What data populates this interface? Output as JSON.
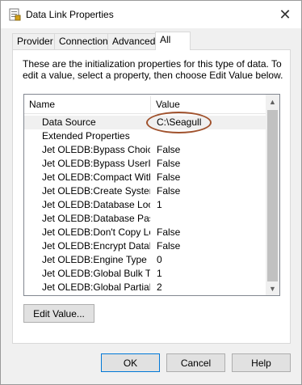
{
  "window": {
    "title": "Data Link Properties",
    "close_glyph": "✕"
  },
  "tabs": [
    {
      "label": "Provider"
    },
    {
      "label": "Connection"
    },
    {
      "label": "Advanced"
    },
    {
      "label": "All"
    }
  ],
  "active_tab": "All",
  "description": "These are the initialization properties for this type of data. To edit a value, select a property, then choose Edit Value below.",
  "list": {
    "columns": [
      "Name",
      "Value"
    ],
    "rows": [
      {
        "name": "Data Source",
        "value": "C:\\Seagull"
      },
      {
        "name": "Extended Properties",
        "value": ""
      },
      {
        "name": "Jet OLEDB:Bypass Choic...",
        "value": "False"
      },
      {
        "name": "Jet OLEDB:Bypass UserIn...",
        "value": "False"
      },
      {
        "name": "Jet OLEDB:Compact With...",
        "value": "False"
      },
      {
        "name": "Jet OLEDB:Create System...",
        "value": "False"
      },
      {
        "name": "Jet OLEDB:Database Loc...",
        "value": "1"
      },
      {
        "name": "Jet OLEDB:Database Pas...",
        "value": ""
      },
      {
        "name": "Jet OLEDB:Don't Copy Lo...",
        "value": "False"
      },
      {
        "name": "Jet OLEDB:Encrypt Datab...",
        "value": "False"
      },
      {
        "name": "Jet OLEDB:Engine Type",
        "value": "0"
      },
      {
        "name": "Jet OLEDB:Global Bulk Tr...",
        "value": "1"
      },
      {
        "name": "Jet OLEDB:Global Partial ...",
        "value": "2"
      }
    ],
    "selected_row": 0,
    "scroll_up_glyph": "▲",
    "scroll_down_glyph": "▼"
  },
  "buttons": {
    "edit_value": "Edit Value...",
    "ok": "OK",
    "cancel": "Cancel",
    "help": "Help"
  },
  "colors": {
    "highlight_ring": "#a0522d",
    "selection": "#f0f0f0",
    "default_button_border": "#0078d7"
  },
  "icons": {
    "title": "data-link-icon"
  }
}
